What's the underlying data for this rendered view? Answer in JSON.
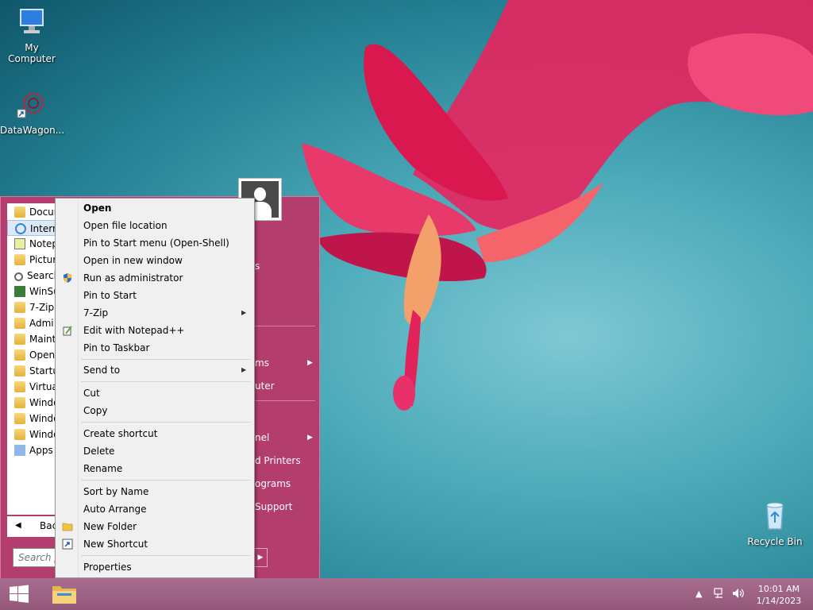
{
  "desktop": {
    "icons": [
      {
        "label": "My Computer",
        "icon": "computer-icon"
      },
      {
        "label": "DataWagon...",
        "icon": "datawagon-shortcut-icon"
      },
      {
        "label": "Recycle Bin",
        "icon": "recycle-bin-icon"
      }
    ]
  },
  "start_menu": {
    "programs": [
      "Docur",
      "Intern",
      "Notep",
      "Pictur",
      "Searcl",
      "WinS(",
      "7-Zip",
      "Admi",
      "Maint",
      "Open",
      "Startu",
      "Virtua",
      "Windo",
      "Windo",
      "Windo",
      "Apps"
    ],
    "back_label": "Bac",
    "search_placeholder": "Search p",
    "right_items": [
      "s",
      "ms",
      "uter",
      "nel",
      "d Printers",
      "ograms",
      "Support"
    ]
  },
  "context_menu": {
    "items": [
      {
        "label": "Open",
        "bold": true
      },
      {
        "label": "Open file location"
      },
      {
        "label": "Pin to Start menu (Open-Shell)"
      },
      {
        "label": "Open in new window"
      },
      {
        "label": "Run as administrator",
        "icon": "uac-shield-icon"
      },
      {
        "label": "Pin to Start"
      },
      {
        "label": "7-Zip",
        "submenu": true
      },
      {
        "label": "Edit with Notepad++",
        "icon": "notepad-plus-plus-icon"
      },
      {
        "label": "Pin to Taskbar"
      },
      {
        "label": "Send to",
        "submenu": true
      },
      {
        "label": "Cut"
      },
      {
        "label": "Copy"
      },
      {
        "label": "Create shortcut"
      },
      {
        "label": "Delete"
      },
      {
        "label": "Rename"
      },
      {
        "label": "Sort by Name"
      },
      {
        "label": "Auto Arrange"
      },
      {
        "label": "New Folder",
        "icon": "folder-icon"
      },
      {
        "label": "New Shortcut",
        "icon": "shortcut-icon"
      },
      {
        "label": "Properties"
      }
    ]
  },
  "taskbar": {
    "clock_time": "10:01 AM",
    "clock_date": "1/14/2023",
    "tray_up_arrow": "▲",
    "colors": {
      "start_menu_bg": "#b33d6c",
      "taskbar_bg": "#a86e8f"
    }
  }
}
